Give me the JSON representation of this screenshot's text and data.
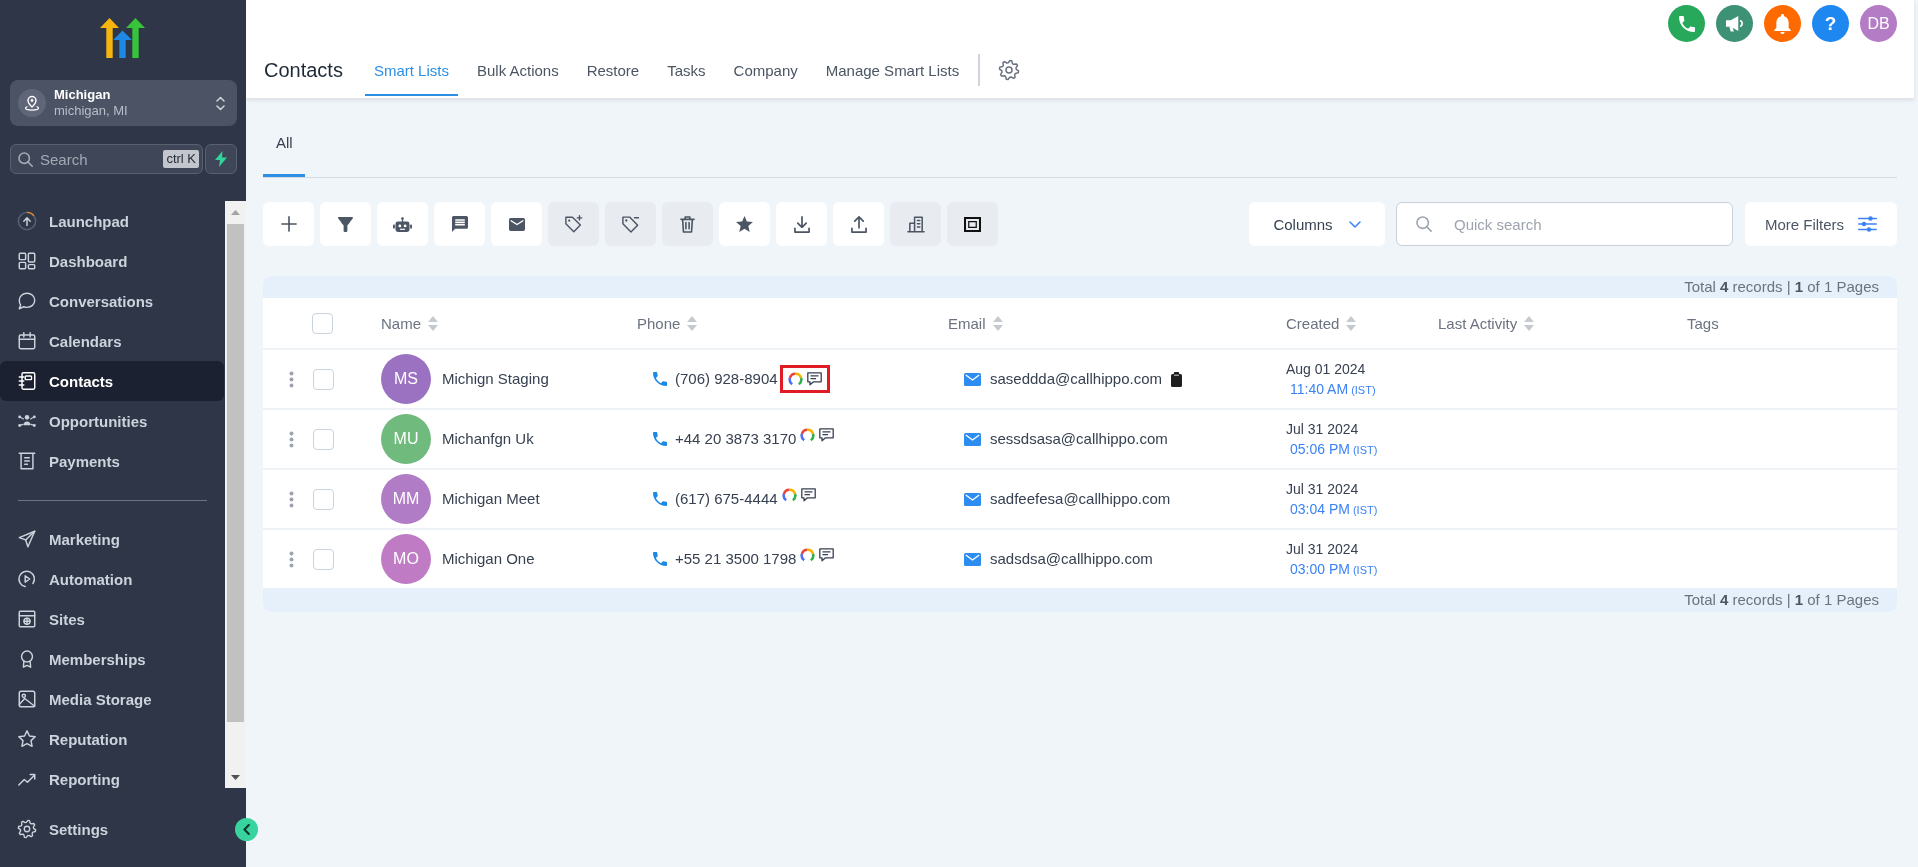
{
  "sidebar": {
    "location": {
      "name": "Michigan",
      "detail": "michigan, MI"
    },
    "search": {
      "placeholder": "Search",
      "shortcut": "ctrl K"
    },
    "nav_sections": [
      {
        "items": [
          {
            "label": "Launchpad",
            "selected": false
          },
          {
            "label": "Dashboard",
            "selected": false
          },
          {
            "label": "Conversations",
            "selected": false
          },
          {
            "label": "Calendars",
            "selected": false
          },
          {
            "label": "Contacts",
            "selected": true
          },
          {
            "label": "Opportunities",
            "selected": false
          },
          {
            "label": "Payments",
            "selected": false
          }
        ]
      },
      {
        "items": [
          {
            "label": "Marketing",
            "selected": false
          },
          {
            "label": "Automation",
            "selected": false
          },
          {
            "label": "Sites",
            "selected": false
          },
          {
            "label": "Memberships",
            "selected": false
          },
          {
            "label": "Media Storage",
            "selected": false
          },
          {
            "label": "Reputation",
            "selected": false
          },
          {
            "label": "Reporting",
            "selected": false
          }
        ]
      }
    ],
    "settings": {
      "label": "Settings",
      "selected": false
    }
  },
  "top_bar": {
    "help_label": "?",
    "user_initials": "DB"
  },
  "header": {
    "title": "Contacts",
    "tabs": [
      {
        "label": "Smart Lists",
        "selected": true
      },
      {
        "label": "Bulk Actions",
        "selected": false
      },
      {
        "label": "Restore",
        "selected": false
      },
      {
        "label": "Tasks",
        "selected": false
      },
      {
        "label": "Company",
        "selected": false
      },
      {
        "label": "Manage Smart Lists",
        "selected": false
      }
    ]
  },
  "list_tabs": [
    {
      "label": "All",
      "selected": true
    }
  ],
  "toolbar": {
    "buttons": [
      {
        "disabled": false
      },
      {
        "disabled": false
      },
      {
        "disabled": false
      },
      {
        "disabled": false
      },
      {
        "disabled": false
      },
      {
        "disabled": true
      },
      {
        "disabled": true
      },
      {
        "disabled": true
      },
      {
        "disabled": false
      },
      {
        "disabled": false
      },
      {
        "disabled": false
      },
      {
        "disabled": true
      },
      {
        "disabled": true
      }
    ],
    "columns_button": "Columns",
    "search": {
      "placeholder": "Quick search"
    },
    "more_filters": "More Filters"
  },
  "table": {
    "summary_top": "Total **4** records | **1** of 1 Pages",
    "select_all": {
      "checked": false
    },
    "columns": [
      {
        "label": "Name",
        "sortable": true
      },
      {
        "label": "Phone",
        "sortable": true
      },
      {
        "label": "Email",
        "sortable": true
      },
      {
        "label": "Created",
        "sortable": true
      },
      {
        "label": "Last Activity",
        "sortable": true
      },
      {
        "label": "Tags",
        "sortable": false
      }
    ],
    "rows": [
      {
        "checked": false,
        "initials": "MS",
        "color": "#9b72c1",
        "name": "Michign Staging",
        "phone": "(706) 928-8904",
        "highlighted": true,
        "email": "saseddda@callhippo.com",
        "copy_icon": true,
        "created_date": "Aug 01 2024",
        "created_time": "11:40 AM",
        "timezone": "(IST)"
      },
      {
        "checked": false,
        "initials": "MU",
        "color": "#6fba7c",
        "name": "Michanfgn Uk",
        "phone": "+44 20 3873 3170",
        "highlighted": false,
        "email": "sessdsasa@callhippo.com",
        "copy_icon": false,
        "created_date": "Jul 31 2024",
        "created_time": "05:06 PM",
        "timezone": "(IST)"
      },
      {
        "checked": false,
        "initials": "MM",
        "color": "#b07cc6",
        "name": "Michigan Meet",
        "phone": "(617) 675-4444",
        "highlighted": false,
        "email": "sadfeefesa@callhippo.com",
        "copy_icon": false,
        "created_date": "Jul 31 2024",
        "created_time": "03:04 PM",
        "timezone": "(IST)"
      },
      {
        "checked": false,
        "initials": "MO",
        "color": "#bf7cc5",
        "name": "Michigan One",
        "phone": "+55 21 3500 1798",
        "highlighted": false,
        "email": "sadsdsa@callhippo.com",
        "copy_icon": false,
        "created_date": "Jul 31 2024",
        "created_time": "03:00 PM",
        "timezone": "(IST)"
      }
    ],
    "summary_bottom": "Total **4** records | **1** of 1 Pages"
  }
}
